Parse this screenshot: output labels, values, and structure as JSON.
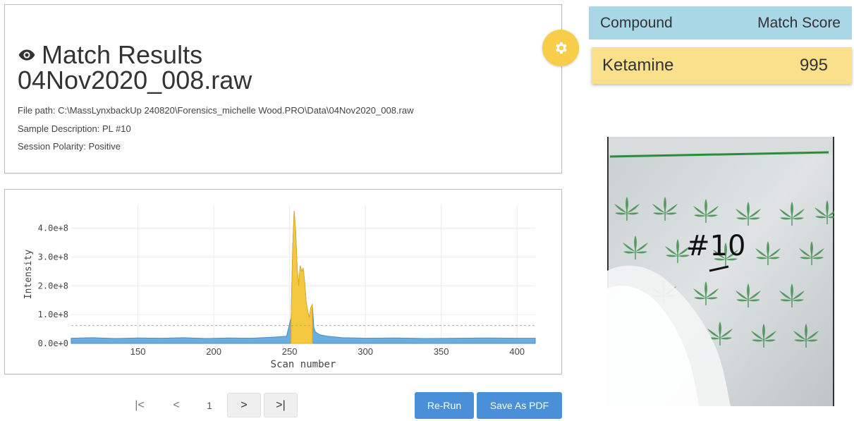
{
  "header": {
    "title": "Match Results",
    "filename": "04Nov2020_008.raw",
    "file_path_label": "File path:",
    "file_path": "C:\\MassLynxbackUp 240820\\Forensics_michelle Wood.PRO\\Data\\04Nov2020_008.raw",
    "sample_description_label": "Sample Description:",
    "sample_description": "PL #10",
    "session_polarity_label": "Session Polarity:",
    "session_polarity": "Positive"
  },
  "icons": {
    "title_icon": "eye-icon",
    "settings_icon": "gear-icon"
  },
  "results": {
    "columns": [
      "Compound",
      "Match Score"
    ],
    "rows": [
      {
        "compound": "Ketamine",
        "score": "995"
      }
    ]
  },
  "colors": {
    "header_bg": "#a9d7e6",
    "row_bg": "#fbe08c",
    "accent_yellow": "#f7cd4a",
    "chrom_blue": "#6aaee0",
    "peak_yellow": "#f5c842",
    "button_blue": "#4a90d9"
  },
  "pagination": {
    "first": "|<",
    "prev": "<",
    "current": "1",
    "next": ">",
    "last": ">|"
  },
  "actions": {
    "rerun": "Re-Run",
    "save_pdf": "Save As PDF"
  },
  "chart_data": {
    "type": "area",
    "xlabel": "Scan number",
    "ylabel": "Intensity",
    "x_ticks": [
      "150",
      "200",
      "250",
      "300",
      "350",
      "400"
    ],
    "y_ticks": [
      "0.0e+0",
      "1.0e+8",
      "2.0e+8",
      "3.0e+8",
      "4.0e+8"
    ],
    "xlim": [
      106,
      412
    ],
    "ylim": [
      0,
      480000000.0
    ],
    "threshold": 62000000.0,
    "highlight_range": [
      251,
      265
    ],
    "series": [
      {
        "x": [
          106,
          120,
          135,
          150,
          165,
          180,
          195,
          210,
          225,
          240,
          248,
          251,
          252,
          253,
          254,
          255,
          256,
          257,
          258,
          259,
          260,
          261,
          262,
          263,
          264,
          265,
          266,
          267,
          270,
          275,
          285,
          300,
          320,
          340,
          360,
          380,
          400,
          412
        ],
        "y": [
          18000000.0,
          20000000.0,
          17000000.0,
          19000000.0,
          18000000.0,
          20000000.0,
          17000000.0,
          19000000.0,
          18000000.0,
          22000000.0,
          25000000.0,
          90000000.0,
          320000000.0,
          460000000.0,
          390000000.0,
          260000000.0,
          200000000.0,
          270000000.0,
          250000000.0,
          260000000.0,
          210000000.0,
          140000000.0,
          110000000.0,
          90000000.0,
          125000000.0,
          135000000.0,
          55000000.0,
          40000000.0,
          30000000.0,
          25000000.0,
          20000000.0,
          18000000.0,
          19000000.0,
          17000000.0,
          18000000.0,
          19000000.0,
          18000000.0,
          18000000.0
        ]
      }
    ]
  }
}
